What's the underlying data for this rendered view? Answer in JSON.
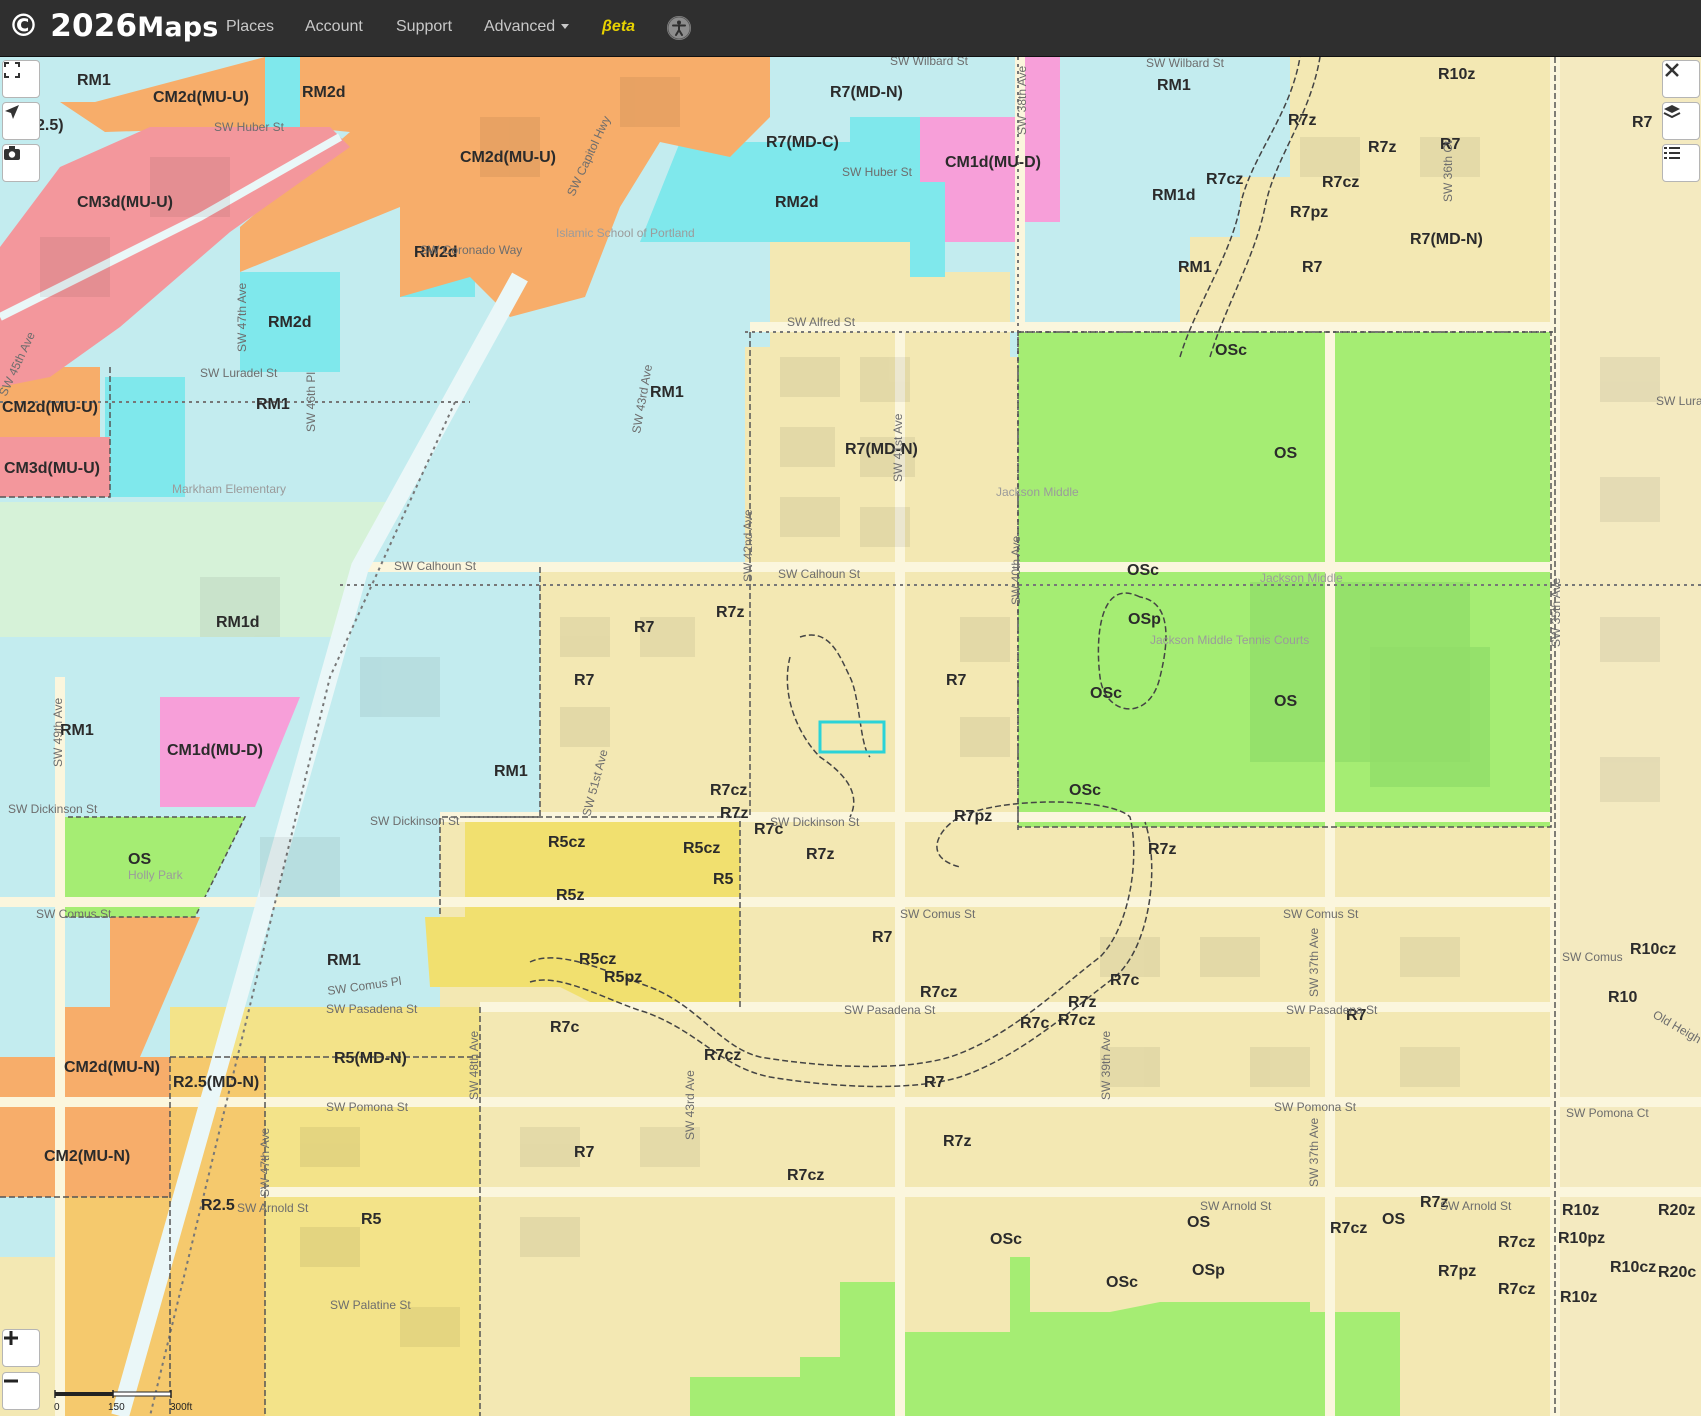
{
  "app": {
    "logo_text": "© 2026",
    "logo_tail": "Maps"
  },
  "nav": {
    "places": "Places",
    "account": "Account",
    "support": "Support",
    "advanced": "Advanced",
    "beta": "βeta"
  },
  "map": {
    "scale_labels": [
      "0",
      "150",
      "300ft"
    ],
    "selected_parcel_color": "#2bd3d8",
    "zone_colors": {
      "RM": "#c3ecef",
      "RM2d": "#7fe8ec",
      "CM2d": "#f7ad6a",
      "CM3d": "#f3979c",
      "CM1d": "#f79fd9",
      "R7": "#f3e8b3",
      "R5": "#f1e06f",
      "OS": "#a5ed73"
    },
    "zone_labels": [
      "RM1",
      "CM2d(MU-U)",
      "RM2d",
      "2.5)",
      "CM3d(MU-U)",
      "CM2d(MU-U)",
      "RM2d",
      "RM2d",
      "CM2d(MU-U)",
      "RM1",
      "CM3d(MU-U)",
      "R7(MD-N)",
      "R7(MD-C)",
      "CM1d(MU-D)",
      "RM2d",
      "RM1",
      "R10z",
      "R7z",
      "R7z",
      "R7",
      "R7",
      "R7cz",
      "R7cz",
      "RM1d",
      "R7pz",
      "R7(MD-N)",
      "R7",
      "RM1",
      "OSc",
      "RM1",
      "R7(MD-N)",
      "OS",
      "RM1d",
      "R7",
      "R7z",
      "R7",
      "OSc",
      "OSp",
      "R7",
      "OSc",
      "OS",
      "RM1",
      "CM1d(MU-D)",
      "RM1",
      "R7cz",
      "R7z",
      "R7c",
      "R7z",
      "R7pz",
      "OSc",
      "R7z",
      "OS",
      "R5cz",
      "R5cz",
      "R5",
      "R5z",
      "R5cz",
      "R5pz",
      "RM1",
      "R7",
      "R7cz",
      "R7z",
      "R7c",
      "R7cz",
      "R7c",
      "R10cz",
      "R10",
      "R7",
      "CM2d(MU-N)",
      "R2.5(MD-N)",
      "R5(MD-N)",
      "R7c",
      "R7cz",
      "R7",
      "CM2(MU-N)",
      "R7",
      "R7z",
      "R7cz",
      "R2.5",
      "R5",
      "OSc",
      "OS",
      "OSc",
      "OSp",
      "R7cz",
      "OS",
      "R7z",
      "R10z",
      "R10pz",
      "R7cz",
      "R7pz",
      "R20z",
      "R10cz",
      "R20c",
      "R7cz",
      "R10z"
    ],
    "street_labels": [
      "SW Wilbard St",
      "SW Wilbard St",
      "SW Huber St",
      "SW Huber St",
      "SW Capitol Hwy",
      "SW Alfred St",
      "SW Luradel St",
      "SW 46th Pl",
      "SW 47th Ave",
      "SW 43rd Ave",
      "SW 42nd Ave",
      "SW 41st Ave",
      "SW 40th Ave",
      "SW 38th Ave",
      "SW 36th Ct",
      "SW 35th Ave",
      "SW Lura",
      "SW Coronado Way",
      "SW Calhoun St",
      "SW Calhoun St",
      "SW Dickinson St",
      "SW Dickinson St",
      "SW Dickinson St",
      "SW 49th Ave",
      "SW Comus St",
      "SW Comus St",
      "SW Comus St",
      "SW Comus Pl",
      "SW Comus",
      "SW Pasadena St",
      "SW Pasadena St",
      "SW Pasadena St",
      "SW 39th Ave",
      "SW 37th Ave",
      "SW 37th Ave",
      "SW Pomona St",
      "SW Pomona St",
      "SW Pomona Ct",
      "SW Arnold St",
      "SW Arnold St",
      "SW Arnold St",
      "SW Palatine St",
      "SW 48th Ave",
      "SW 43rd Ave",
      "SW 51st Ave",
      "SW 47th Ave",
      "Old Heigh",
      "SW 45th Ave"
    ],
    "place_labels": [
      "Islamic School of Portland",
      "Markham Elementary",
      "Jackson Middle",
      "Jackson Middle",
      "Holly Park",
      "Jackson Middle Tennis Courts"
    ]
  }
}
